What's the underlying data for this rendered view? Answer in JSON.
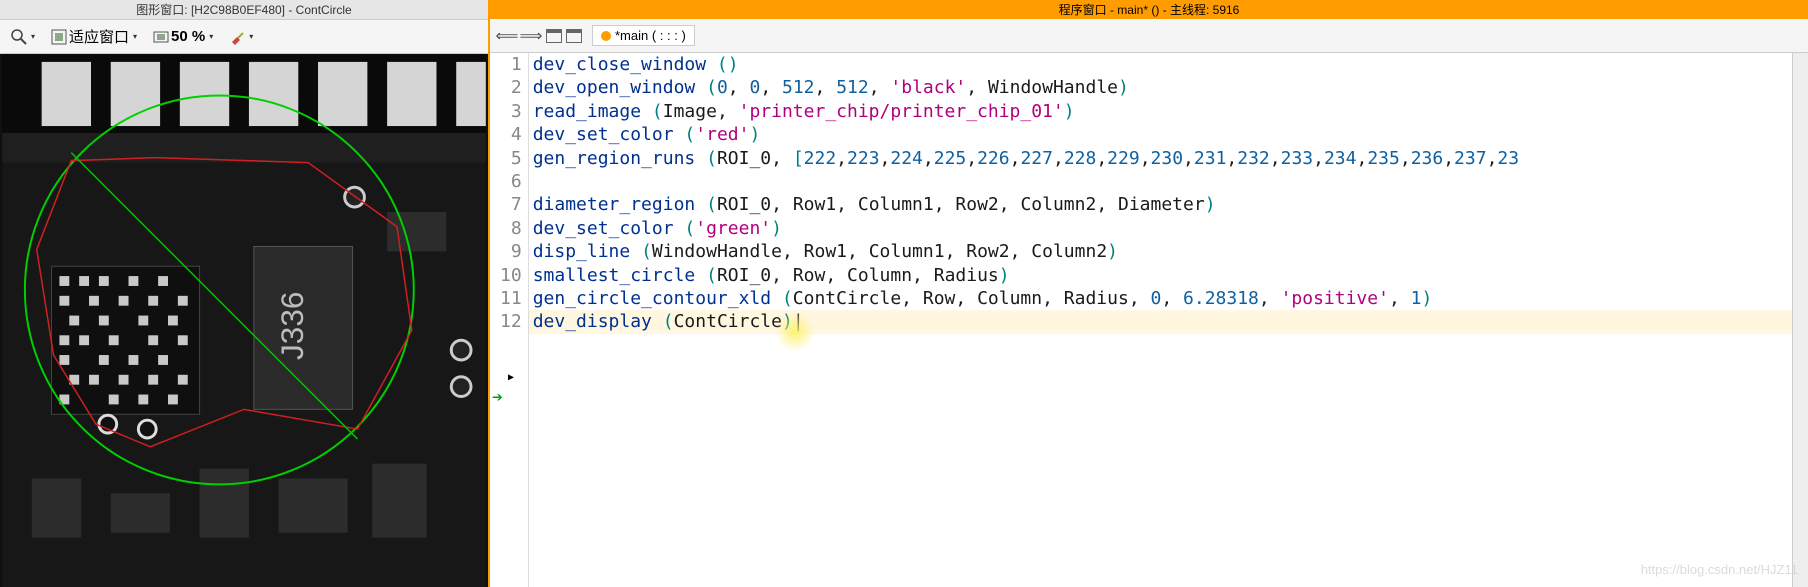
{
  "left": {
    "title": "图形窗口: [H2C98B0EF480] - ContCircle",
    "toolbar": {
      "fit_label": "适应窗口",
      "zoom_label": "50 %"
    }
  },
  "right": {
    "title": "程序窗口 - main* () - 主线程: 5916",
    "tab": "*main ( : : : )",
    "code": [
      "dev_close_window ()",
      "dev_open_window (0, 0, 512, 512, 'black', WindowHandle)",
      "read_image (Image, 'printer_chip/printer_chip_01')",
      "dev_set_color ('red')",
      "gen_region_runs (ROI_0, [222,223,224,225,226,227,228,229,230,231,232,233,234,235,236,237,23",
      "",
      "diameter_region (ROI_0, Row1, Column1, Row2, Column2, Diameter)",
      "dev_set_color ('green')",
      "disp_line (WindowHandle, Row1, Column1, Row2, Column2)",
      "smallest_circle (ROI_0, Row, Column, Radius)",
      "gen_circle_contour_xld (ContCircle, Row, Column, Radius, 0, 6.28318, 'positive', 1)",
      "dev_display (ContCircle)"
    ],
    "current_line": 12,
    "arrow_line": 13
  },
  "watermark": "https://blog.csdn.net/HJZ11"
}
